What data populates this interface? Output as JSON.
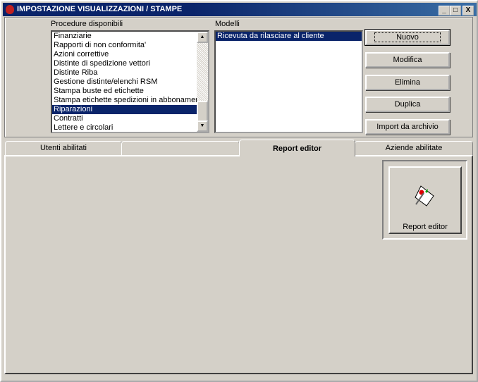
{
  "window": {
    "title": "IMPOSTAZIONE VISUALIZZAZIONI / STAMPE",
    "minimize": "_",
    "maximize": "□",
    "close": "X"
  },
  "procedure": {
    "label": "Procedure disponibili",
    "items": [
      "Finanziarie",
      "Rapporti di non conformita'",
      "Azioni correttive",
      "Distinte di spedizione vettori",
      "Distinte Riba",
      "Gestione distinte/elenchi RSM",
      "Stampa buste ed etichette",
      "Stampa etichette spedizioni in abbonament",
      "Riparazioni",
      "Contratti",
      "Lettere e circolari"
    ],
    "selected": "Riparazioni"
  },
  "modelli": {
    "label": "Modelli",
    "items": [
      "Ricevuta da rilasciare al cliente"
    ]
  },
  "buttons": {
    "nuovo": "Nuovo",
    "modifica": "Modifica",
    "elimina": "Elimina",
    "duplica": "Duplica",
    "import": "Import da archivio"
  },
  "tabs": [
    "Utenti abilitati",
    "",
    "Report editor",
    "Aziende abilitate"
  ],
  "active_tab": "Report editor",
  "report_editor": {
    "button_label": "Report editor"
  }
}
